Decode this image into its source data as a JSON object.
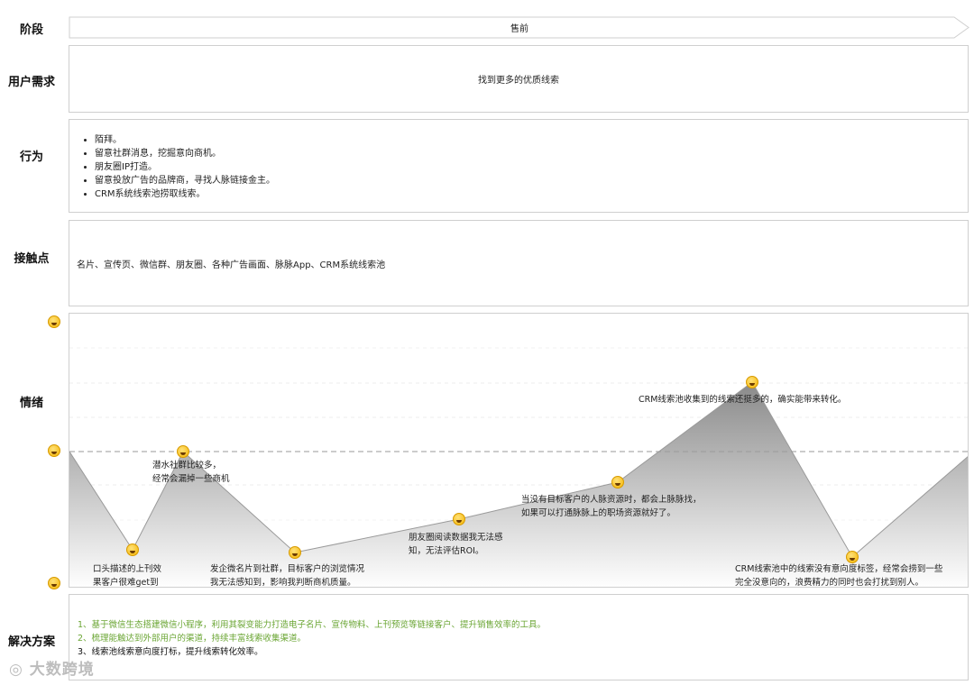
{
  "labels": {
    "stage": "阶段",
    "needs": "用户需求",
    "behavior": "行为",
    "touchpoints": "接触点",
    "emotion": "情绪",
    "solution": "解决方案"
  },
  "stage": {
    "value": "售前"
  },
  "needs": {
    "value": "找到更多的优质线索"
  },
  "behavior": {
    "items": [
      "陌拜。",
      "留意社群消息，挖掘意向商机。",
      "朋友圈IP打造。",
      "留意投放广告的品牌商，寻找人脉链接金主。",
      "CRM系统线索池捞取线索。"
    ]
  },
  "touchpoints": {
    "value": "名片、宣传页、微信群、朋友圈、各种广告画面、脉脉App、CRM系统线索池"
  },
  "emotion": {
    "annotations": [
      "潜水社群比较多，\n经常会漏掉一些商机",
      "口头描述的上刊效\n果客户很难get到",
      "发企微名片到社群，目标客户的浏览情况\n我无法感知到，影响我判断商机质量。",
      "朋友圈阅读数据我无法感\n知，无法评估ROI。",
      "当没有目标客户的人脉资源时，都会上脉脉找，\n如果可以打通脉脉上的职场资源就好了。",
      "CRM线索池收集到的线索还挺多的，确实能带来转化。",
      "CRM线索池中的线索没有意向度标签，经常会捞到一些\n完全没意向的，浪费精力的同时也会打扰到别人。"
    ]
  },
  "solution": {
    "items": [
      {
        "text": "1、基于微信生态搭建微信小程序，利用其裂变能力打造电子名片、宣传物料、上刊预览等链接客户、提升销售效率的工具。",
        "color": "#6aa533"
      },
      {
        "text": "2、梳理能触达到外部用户的渠道，持续丰富线索收集渠道。",
        "color": "#6aa533"
      },
      {
        "text": "3、线索池线索意向度打标，提升线索转化效率。",
        "color": "#111111"
      }
    ]
  },
  "watermark": "大数跨境"
}
